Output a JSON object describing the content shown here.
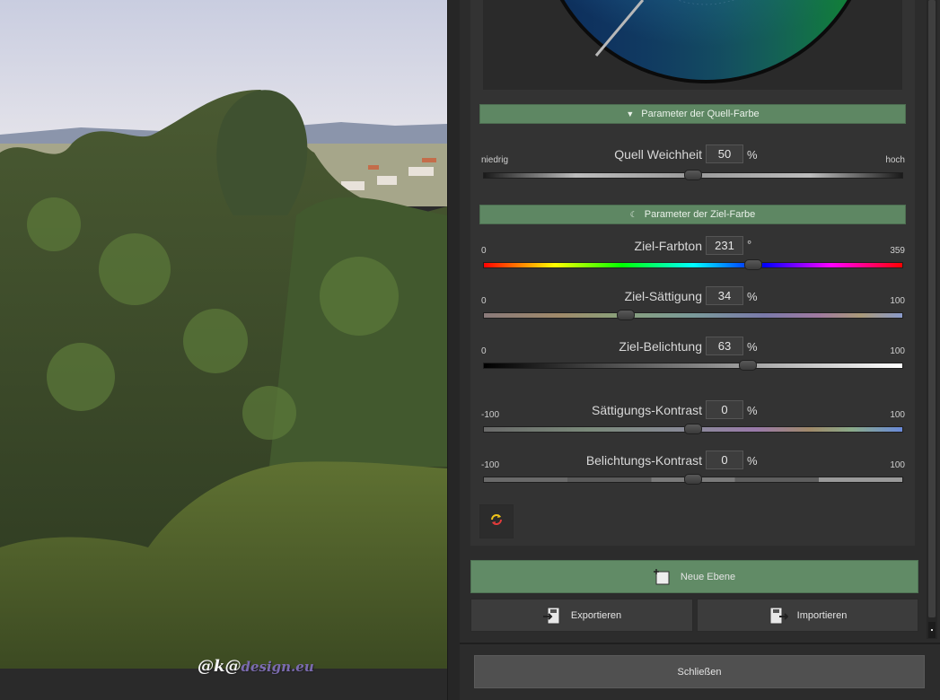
{
  "watermark": {
    "prefix": "@k@",
    "domain": "design.eu"
  },
  "sections": {
    "source": {
      "label": "Parameter der Quell-Farbe",
      "icon": "triangle-down-icon"
    },
    "target": {
      "label": "Parameter der Ziel-Farbe",
      "icon": "moon-icon"
    }
  },
  "sliders": [
    {
      "id": "quell-weichheit",
      "label": "Quell Weichheit",
      "value": "50",
      "unit": "%",
      "min": "niedrig",
      "max": "hoch",
      "fraction": 0.5
    },
    {
      "id": "ziel-farbton",
      "label": "Ziel-Farbton",
      "value": "231",
      "unit": "°",
      "min": "0",
      "max": "359",
      "fraction": 0.6435
    },
    {
      "id": "ziel-saettigung",
      "label": "Ziel-Sättigung",
      "value": "34",
      "unit": "%",
      "min": "0",
      "max": "100",
      "fraction": 0.34
    },
    {
      "id": "ziel-belichtung",
      "label": "Ziel-Belichtung",
      "value": "63",
      "unit": "%",
      "min": "0",
      "max": "100",
      "fraction": 0.63
    },
    {
      "id": "saettigungs-kontrast",
      "label": "Sättigungs-Kontrast",
      "value": "0",
      "unit": "%",
      "min": "-100",
      "max": "100",
      "fraction": 0.5
    },
    {
      "id": "belichtungs-kontrast",
      "label": "Belichtungs-Kontrast",
      "value": "0",
      "unit": "%",
      "min": "-100",
      "max": "100",
      "fraction": 0.5
    }
  ],
  "buttons": {
    "reset_icon": "refresh-icon",
    "new_layer": "Neue Ebene",
    "export": "Exportieren",
    "import": "Importieren",
    "close": "Schließen"
  },
  "colors": {
    "accent_green": "#5e8763",
    "panel": "#333333"
  }
}
